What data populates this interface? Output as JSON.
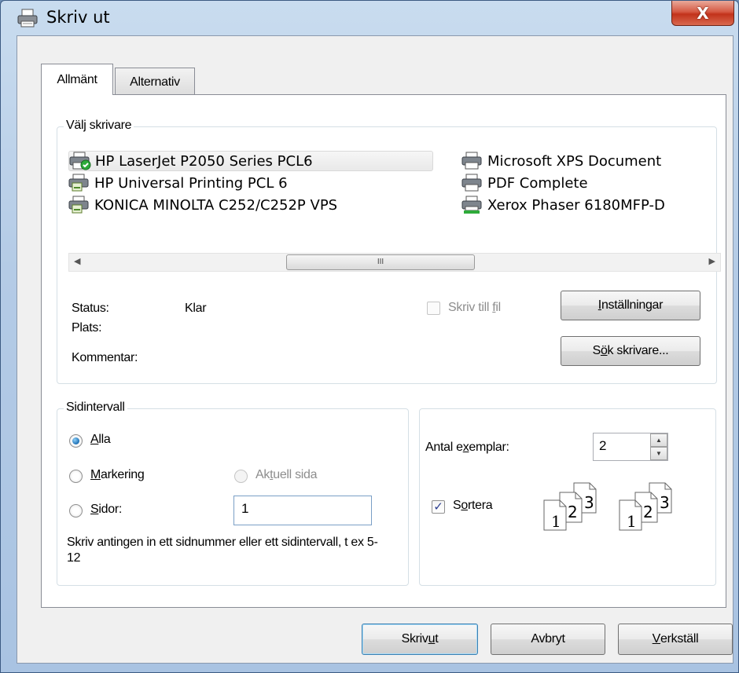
{
  "window": {
    "title": "Skriv ut",
    "close_glyph": "X"
  },
  "tabs": [
    {
      "label": "Allmänt",
      "active": true
    },
    {
      "label": "Alternativ",
      "active": false
    }
  ],
  "printer_group": {
    "label": "Välj skrivare",
    "printers": [
      {
        "name": "HP LaserJet P2050 Series PCL6",
        "icon": "default-printer-icon",
        "selected": true
      },
      {
        "name": "HP Universal Printing PCL 6",
        "icon": "network-printer-icon",
        "selected": false
      },
      {
        "name": "KONICA MINOLTA C252/C252P VPS",
        "icon": "network-printer-icon",
        "selected": false
      },
      {
        "name": "Microsoft XPS Document",
        "icon": "printer-icon",
        "selected": false
      },
      {
        "name": "PDF Complete",
        "icon": "printer-icon",
        "selected": false
      },
      {
        "name": "Xerox Phaser 6180MFP-D",
        "icon": "shared-printer-icon",
        "selected": false
      }
    ],
    "scroll_thumb_glyph": "III",
    "status_label": "Status:",
    "status_value": "Klar",
    "location_label": "Plats:",
    "comment_label": "Kommentar:",
    "print_to_file_pre": "Skriv till ",
    "print_to_file_key": "f",
    "print_to_file_post": "il",
    "settings_key": "I",
    "settings_post": "nställningar",
    "find_printer_pre": "S",
    "find_printer_key": "ö",
    "find_printer_post": "k skrivare..."
  },
  "page_range": {
    "label": "Sidintervall",
    "all_key": "A",
    "all_post": "lla",
    "selection_key": "M",
    "selection_post": "arkering",
    "current_pre": "Ak",
    "current_key": "t",
    "current_post": "uell sida",
    "pages_key": "S",
    "pages_post": "idor:",
    "pages_value": "1",
    "hint": "Skriv antingen in ett sidnummer eller ett sidintervall, t ex 5-12",
    "selected_option": "all"
  },
  "copies": {
    "label_pre": "Antal e",
    "label_key": "x",
    "label_post": "emplar:",
    "value": "2",
    "collate_pre": "S",
    "collate_key": "o",
    "collate_post": "rtera",
    "collate_checked": true,
    "collate_pages": [
      "1",
      "2",
      "3"
    ]
  },
  "buttons": {
    "print_pre": "Skriv ",
    "print_key": "u",
    "print_post": "t",
    "cancel": "Avbryt",
    "apply_key": "V",
    "apply_post": "erkställ"
  },
  "colors": {
    "title_gradient_top": "#c9dcef",
    "close_red": "#c2321b",
    "default_button_border": "#3c7fb1",
    "radio_checked": "#1c6fb5"
  }
}
